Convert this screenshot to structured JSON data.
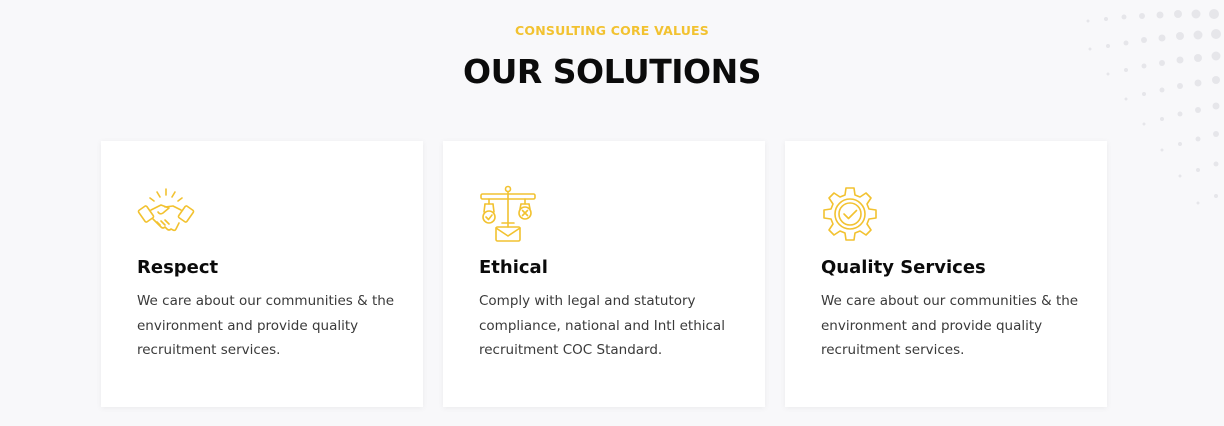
{
  "header": {
    "eyebrow": "CONSULTING CORE VALUES",
    "title": "OUR SOLUTIONS"
  },
  "cards": [
    {
      "icon": "handshake-icon",
      "title": "Respect",
      "text": "We care about our communities & the environment and provide quality recruitment services."
    },
    {
      "icon": "scale-justice-icon",
      "title": "Ethical",
      "text": "Comply with legal and statutory compliance, national and Intl ethical recruitment COC Standard."
    },
    {
      "icon": "gear-check-icon",
      "title": "Quality Services",
      "text": "We care about our communities & the environment and provide quality recruitment services."
    }
  ],
  "colors": {
    "accent": "#f2c230",
    "title": "#0b0b0b",
    "text": "#3a3a3a",
    "card": "#ffffff",
    "background": "#f8f8fa"
  }
}
